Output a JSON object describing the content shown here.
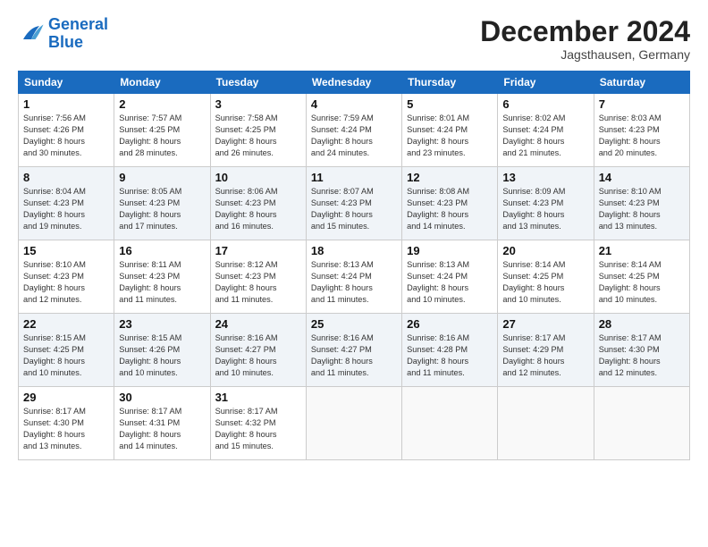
{
  "header": {
    "logo_line1": "General",
    "logo_line2": "Blue",
    "month": "December 2024",
    "location": "Jagsthausen, Germany"
  },
  "weekdays": [
    "Sunday",
    "Monday",
    "Tuesday",
    "Wednesday",
    "Thursday",
    "Friday",
    "Saturday"
  ],
  "weeks": [
    [
      {
        "day": "1",
        "lines": [
          "Sunrise: 7:56 AM",
          "Sunset: 4:26 PM",
          "Daylight: 8 hours",
          "and 30 minutes."
        ]
      },
      {
        "day": "2",
        "lines": [
          "Sunrise: 7:57 AM",
          "Sunset: 4:25 PM",
          "Daylight: 8 hours",
          "and 28 minutes."
        ]
      },
      {
        "day": "3",
        "lines": [
          "Sunrise: 7:58 AM",
          "Sunset: 4:25 PM",
          "Daylight: 8 hours",
          "and 26 minutes."
        ]
      },
      {
        "day": "4",
        "lines": [
          "Sunrise: 7:59 AM",
          "Sunset: 4:24 PM",
          "Daylight: 8 hours",
          "and 24 minutes."
        ]
      },
      {
        "day": "5",
        "lines": [
          "Sunrise: 8:01 AM",
          "Sunset: 4:24 PM",
          "Daylight: 8 hours",
          "and 23 minutes."
        ]
      },
      {
        "day": "6",
        "lines": [
          "Sunrise: 8:02 AM",
          "Sunset: 4:24 PM",
          "Daylight: 8 hours",
          "and 21 minutes."
        ]
      },
      {
        "day": "7",
        "lines": [
          "Sunrise: 8:03 AM",
          "Sunset: 4:23 PM",
          "Daylight: 8 hours",
          "and 20 minutes."
        ]
      }
    ],
    [
      {
        "day": "8",
        "lines": [
          "Sunrise: 8:04 AM",
          "Sunset: 4:23 PM",
          "Daylight: 8 hours",
          "and 19 minutes."
        ]
      },
      {
        "day": "9",
        "lines": [
          "Sunrise: 8:05 AM",
          "Sunset: 4:23 PM",
          "Daylight: 8 hours",
          "and 17 minutes."
        ]
      },
      {
        "day": "10",
        "lines": [
          "Sunrise: 8:06 AM",
          "Sunset: 4:23 PM",
          "Daylight: 8 hours",
          "and 16 minutes."
        ]
      },
      {
        "day": "11",
        "lines": [
          "Sunrise: 8:07 AM",
          "Sunset: 4:23 PM",
          "Daylight: 8 hours",
          "and 15 minutes."
        ]
      },
      {
        "day": "12",
        "lines": [
          "Sunrise: 8:08 AM",
          "Sunset: 4:23 PM",
          "Daylight: 8 hours",
          "and 14 minutes."
        ]
      },
      {
        "day": "13",
        "lines": [
          "Sunrise: 8:09 AM",
          "Sunset: 4:23 PM",
          "Daylight: 8 hours",
          "and 13 minutes."
        ]
      },
      {
        "day": "14",
        "lines": [
          "Sunrise: 8:10 AM",
          "Sunset: 4:23 PM",
          "Daylight: 8 hours",
          "and 13 minutes."
        ]
      }
    ],
    [
      {
        "day": "15",
        "lines": [
          "Sunrise: 8:10 AM",
          "Sunset: 4:23 PM",
          "Daylight: 8 hours",
          "and 12 minutes."
        ]
      },
      {
        "day": "16",
        "lines": [
          "Sunrise: 8:11 AM",
          "Sunset: 4:23 PM",
          "Daylight: 8 hours",
          "and 11 minutes."
        ]
      },
      {
        "day": "17",
        "lines": [
          "Sunrise: 8:12 AM",
          "Sunset: 4:23 PM",
          "Daylight: 8 hours",
          "and 11 minutes."
        ]
      },
      {
        "day": "18",
        "lines": [
          "Sunrise: 8:13 AM",
          "Sunset: 4:24 PM",
          "Daylight: 8 hours",
          "and 11 minutes."
        ]
      },
      {
        "day": "19",
        "lines": [
          "Sunrise: 8:13 AM",
          "Sunset: 4:24 PM",
          "Daylight: 8 hours",
          "and 10 minutes."
        ]
      },
      {
        "day": "20",
        "lines": [
          "Sunrise: 8:14 AM",
          "Sunset: 4:25 PM",
          "Daylight: 8 hours",
          "and 10 minutes."
        ]
      },
      {
        "day": "21",
        "lines": [
          "Sunrise: 8:14 AM",
          "Sunset: 4:25 PM",
          "Daylight: 8 hours",
          "and 10 minutes."
        ]
      }
    ],
    [
      {
        "day": "22",
        "lines": [
          "Sunrise: 8:15 AM",
          "Sunset: 4:25 PM",
          "Daylight: 8 hours",
          "and 10 minutes."
        ]
      },
      {
        "day": "23",
        "lines": [
          "Sunrise: 8:15 AM",
          "Sunset: 4:26 PM",
          "Daylight: 8 hours",
          "and 10 minutes."
        ]
      },
      {
        "day": "24",
        "lines": [
          "Sunrise: 8:16 AM",
          "Sunset: 4:27 PM",
          "Daylight: 8 hours",
          "and 10 minutes."
        ]
      },
      {
        "day": "25",
        "lines": [
          "Sunrise: 8:16 AM",
          "Sunset: 4:27 PM",
          "Daylight: 8 hours",
          "and 11 minutes."
        ]
      },
      {
        "day": "26",
        "lines": [
          "Sunrise: 8:16 AM",
          "Sunset: 4:28 PM",
          "Daylight: 8 hours",
          "and 11 minutes."
        ]
      },
      {
        "day": "27",
        "lines": [
          "Sunrise: 8:17 AM",
          "Sunset: 4:29 PM",
          "Daylight: 8 hours",
          "and 12 minutes."
        ]
      },
      {
        "day": "28",
        "lines": [
          "Sunrise: 8:17 AM",
          "Sunset: 4:30 PM",
          "Daylight: 8 hours",
          "and 12 minutes."
        ]
      }
    ],
    [
      {
        "day": "29",
        "lines": [
          "Sunrise: 8:17 AM",
          "Sunset: 4:30 PM",
          "Daylight: 8 hours",
          "and 13 minutes."
        ]
      },
      {
        "day": "30",
        "lines": [
          "Sunrise: 8:17 AM",
          "Sunset: 4:31 PM",
          "Daylight: 8 hours",
          "and 14 minutes."
        ]
      },
      {
        "day": "31",
        "lines": [
          "Sunrise: 8:17 AM",
          "Sunset: 4:32 PM",
          "Daylight: 8 hours",
          "and 15 minutes."
        ]
      },
      null,
      null,
      null,
      null
    ]
  ]
}
